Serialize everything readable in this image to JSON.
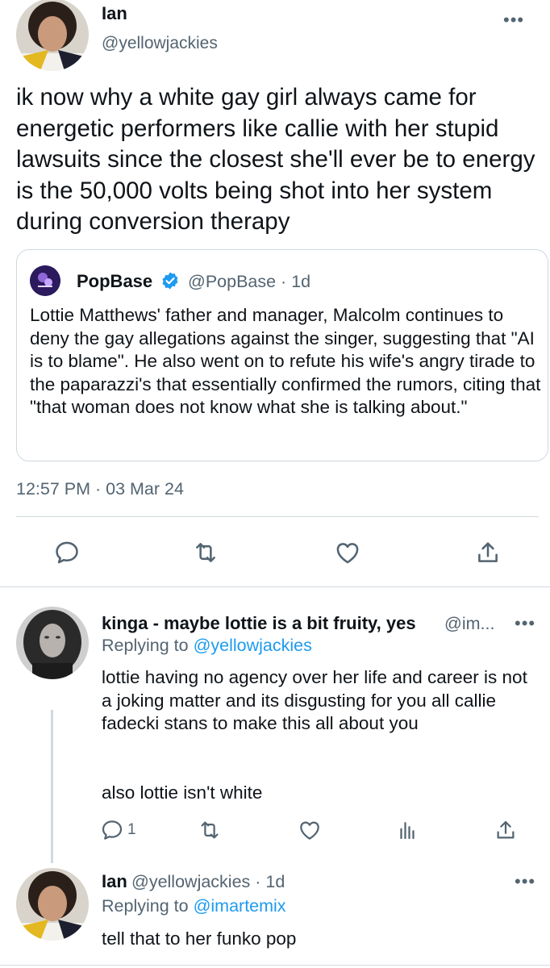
{
  "main_tweet": {
    "display_name": "Ian",
    "handle": "@yellowjackies",
    "text": "ik now why a white gay girl always came for energetic performers like callie with her stupid lawsuits since the closest she'll ever be to energy is the 50,000 volts being shot into her system during conversion therapy",
    "more_label": "•••",
    "timestamp": "12:57 PM · 03 Mar 24"
  },
  "quoted_tweet": {
    "display_name": "PopBase",
    "handle": "@PopBase · 1d",
    "text": "Lottie Matthews' father and manager, Malcolm continues to deny the gay allegations against the singer, suggesting that \"AI is to blame\". He also went on to refute his wife's angry tirade to the paparazzi's that essentially confirmed the rumors, citing that \"that woman does not know what she is talking about.\""
  },
  "replies": [
    {
      "display_name": "kinga - maybe lottie is a bit fruity, yes",
      "handle": "@im...",
      "replying_prefix": "Replying to",
      "replying_to": "@yellowjackies",
      "text_line1": "lottie having no agency over her life and career is not a joking matter and its disgusting for you all callie fadecki stans to make this all about you",
      "text_line2": "also lottie isn't white",
      "reply_count": "1",
      "more_label": "•••"
    },
    {
      "display_name": "Ian",
      "handle": "@yellowjackies · 1d",
      "replying_prefix": "Replying to",
      "replying_to": "@imartemix",
      "text": "tell that to her funko pop",
      "more_label": "•••"
    }
  ],
  "icons": [
    "reply-icon",
    "retweet-icon",
    "like-icon",
    "share-icon",
    "analytics-icon",
    "verified-badge-icon"
  ],
  "colors": {
    "text": "#0f1419",
    "secondary": "#536471",
    "link": "#1d9bf0",
    "border": "#cfd9de"
  }
}
